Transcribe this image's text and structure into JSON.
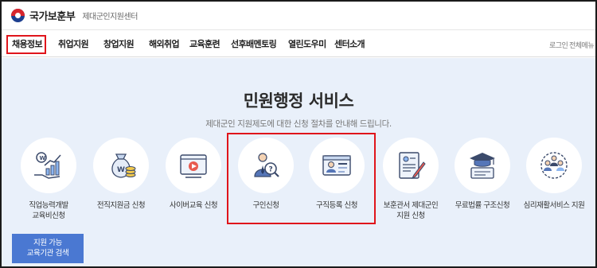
{
  "header": {
    "logo_text": "국가보훈부",
    "logo_subtitle": "제대군인지원센터"
  },
  "nav": {
    "items": [
      {
        "label": "채용정보",
        "active": true
      },
      {
        "label": "취업지원"
      },
      {
        "label": "창업지원"
      },
      {
        "label": "해외취업"
      },
      {
        "label": "교육훈련"
      },
      {
        "label": "선후배멘토링"
      },
      {
        "label": "열린도우미"
      },
      {
        "label": "센터소개"
      }
    ],
    "util_login": "로그인",
    "util_menu": "전체메뉴"
  },
  "hero": {
    "title": "민원행정 서비스",
    "subtitle": "제대군인 지원제도에 대한 신청 절차를 안내해 드립니다."
  },
  "services": [
    {
      "label1": "직업능력개발",
      "label2": "교육비신청",
      "icon": "growth-chart-icon"
    },
    {
      "label1": "전직지원금 신청",
      "label2": "",
      "icon": "money-bag-icon"
    },
    {
      "label1": "사이버교육 신청",
      "label2": "",
      "icon": "video-play-icon"
    },
    {
      "label1": "구인신청",
      "label2": "",
      "icon": "recruiter-search-icon"
    },
    {
      "label1": "구직등록 신청",
      "label2": "",
      "icon": "id-card-icon"
    },
    {
      "label1": "보훈관서 제대군인",
      "label2": "지원 신청",
      "icon": "document-pen-icon"
    },
    {
      "label1": "무료법률 구조신청",
      "label2": "",
      "icon": "graduation-cap-icon"
    },
    {
      "label1": "심리재활서비스 지원",
      "label2": "",
      "icon": "counseling-people-icon"
    }
  ],
  "cta": {
    "line1": "지원 가능",
    "line2": "교육기관 검색"
  },
  "colors": {
    "accent": "#4a78d2",
    "highlight": "#e0151b",
    "hero_bg": "#e9f0fa"
  }
}
